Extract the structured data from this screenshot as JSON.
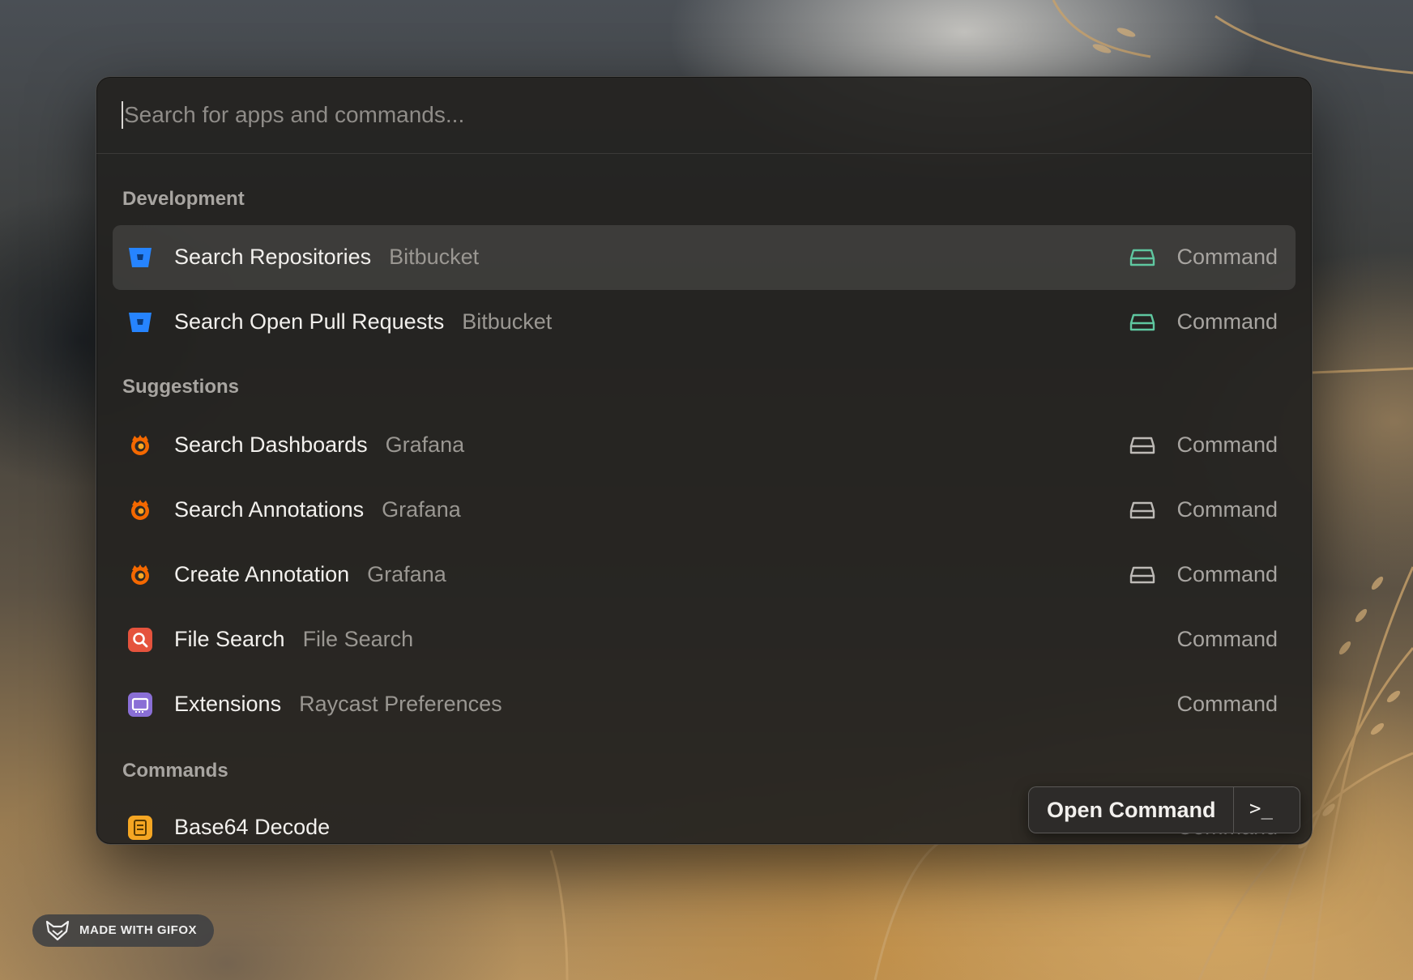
{
  "search": {
    "placeholder": "Search for apps and commands..."
  },
  "sections": {
    "development": "Development",
    "suggestions": "Suggestions",
    "commands": "Commands"
  },
  "items": [
    {
      "title": "Search Repositories",
      "subtitle": "Bitbucket",
      "type": "Command",
      "icon": "bitbucket-icon",
      "accessory": "storage-icon"
    },
    {
      "title": "Search Open Pull Requests",
      "subtitle": "Bitbucket",
      "type": "Command",
      "icon": "bitbucket-icon",
      "accessory": "storage-icon"
    },
    {
      "title": "Search Dashboards",
      "subtitle": "Grafana",
      "type": "Command",
      "icon": "grafana-icon",
      "accessory": "storage-icon"
    },
    {
      "title": "Search Annotations",
      "subtitle": "Grafana",
      "type": "Command",
      "icon": "grafana-icon",
      "accessory": "storage-icon"
    },
    {
      "title": "Create Annotation",
      "subtitle": "Grafana",
      "type": "Command",
      "icon": "grafana-icon",
      "accessory": "storage-icon"
    },
    {
      "title": "File Search",
      "subtitle": "File Search",
      "type": "Command",
      "icon": "file-search-icon"
    },
    {
      "title": "Extensions",
      "subtitle": "Raycast Preferences",
      "type": "Command",
      "icon": "extensions-icon"
    },
    {
      "title": "Base64 Decode",
      "subtitle": "",
      "type": "Command",
      "icon": "base64-icon"
    }
  ],
  "action_bar": {
    "label": "Open Command",
    "shortcut": ">_"
  },
  "watermark": {
    "text": "MADE WITH GIFOX"
  },
  "colors": {
    "bitbucket": "#2684ff",
    "grafana": "#f46800",
    "file_search": "#e5533d",
    "extensions": "#8a6fd6",
    "base64": "#f5a623",
    "accessory_green": "#5fc7a0",
    "accessory_gray": "#bdbab6"
  }
}
